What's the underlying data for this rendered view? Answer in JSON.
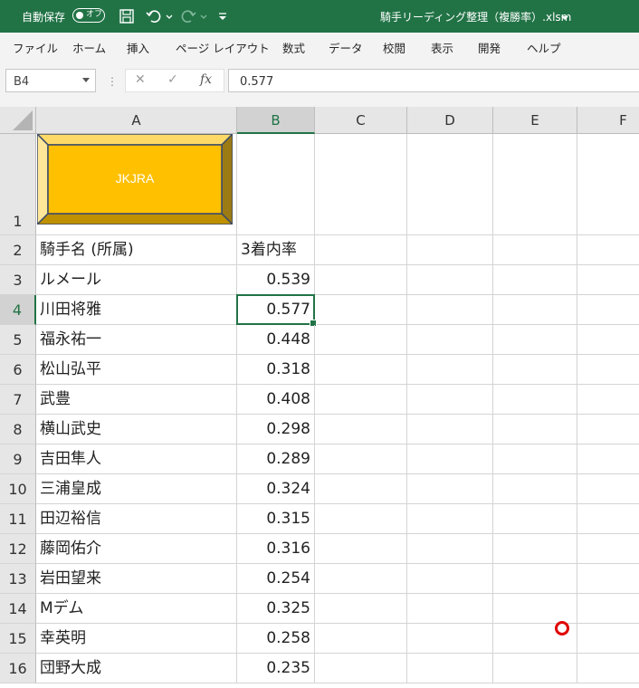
{
  "titlebar": {
    "autosave_label": "自動保存",
    "toggle_state": "オフ",
    "document_title": "騎手リーディング整理（複勝率）.xlsm",
    "icons": [
      "save-icon",
      "undo-icon",
      "redo-icon",
      "customize-qat-icon"
    ]
  },
  "ribbon": {
    "tabs": [
      "ファイル",
      "ホーム",
      "挿入",
      "ページ レイアウト",
      "数式",
      "データ",
      "校閲",
      "表示",
      "開発",
      "ヘルプ"
    ]
  },
  "formula_bar": {
    "name_box": "B4",
    "formula": "0.577",
    "cancel_symbol": "✕",
    "enter_symbol": "✓",
    "fx_symbol": "fx"
  },
  "sheet": {
    "columns": [
      "A",
      "B",
      "C",
      "D",
      "E",
      "F"
    ],
    "selected_column": "B",
    "selected_row": "4",
    "selected_cell": "B4",
    "shape_label": "JKJRA",
    "shape_color": "#FFC000",
    "rows": [
      {
        "num": "1",
        "a": "",
        "b": ""
      },
      {
        "num": "2",
        "a": "騎手名 (所属)",
        "b": "3着内率"
      },
      {
        "num": "3",
        "a": "ルメール",
        "b": "0.539"
      },
      {
        "num": "4",
        "a": "川田将雅",
        "b": "0.577"
      },
      {
        "num": "5",
        "a": "福永祐一",
        "b": "0.448"
      },
      {
        "num": "6",
        "a": "松山弘平",
        "b": "0.318"
      },
      {
        "num": "7",
        "a": "武豊",
        "b": "0.408"
      },
      {
        "num": "8",
        "a": "横山武史",
        "b": "0.298"
      },
      {
        "num": "9",
        "a": "吉田隼人",
        "b": "0.289"
      },
      {
        "num": "10",
        "a": "三浦皇成",
        "b": "0.324"
      },
      {
        "num": "11",
        "a": "田辺裕信",
        "b": "0.315"
      },
      {
        "num": "12",
        "a": "藤岡佑介",
        "b": "0.316"
      },
      {
        "num": "13",
        "a": "岩田望来",
        "b": "0.254"
      },
      {
        "num": "14",
        "a": "Mデム",
        "b": "0.325"
      },
      {
        "num": "15",
        "a": "幸英明",
        "b": "0.258"
      },
      {
        "num": "16",
        "a": "団野大成",
        "b": "0.235"
      }
    ]
  },
  "colors": {
    "accent": "#217346",
    "pointer": "#E00000"
  }
}
